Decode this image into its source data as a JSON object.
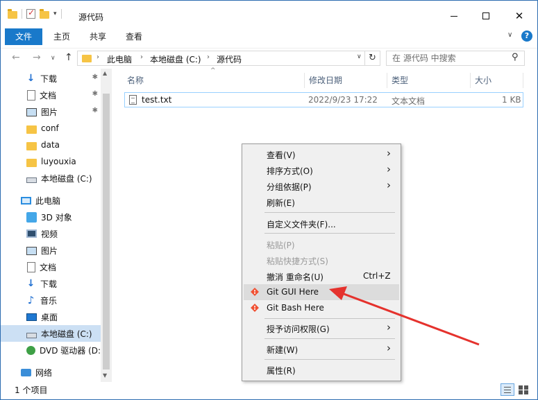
{
  "window": {
    "title": "源代码"
  },
  "ribbon": {
    "file": "文件",
    "home": "主页",
    "share": "共享",
    "view": "查看",
    "help": "?"
  },
  "address": {
    "crumbs": [
      "此电脑",
      "本地磁盘 (C:)",
      "源代码"
    ],
    "sep": "›",
    "search_placeholder": "在 源代码 中搜索"
  },
  "sidebar": {
    "items": [
      {
        "label": "下载",
        "icon": "download-icon",
        "pinned": true
      },
      {
        "label": "文档",
        "icon": "document-icon",
        "pinned": true
      },
      {
        "label": "图片",
        "icon": "picture-icon",
        "pinned": true
      },
      {
        "label": "conf",
        "icon": "folder-icon"
      },
      {
        "label": "data",
        "icon": "folder-icon"
      },
      {
        "label": "luyouxia",
        "icon": "folder-icon"
      },
      {
        "label": "本地磁盘 (C:)",
        "icon": "drive-icon"
      },
      {
        "label": "此电脑",
        "icon": "pc-icon"
      },
      {
        "label": "3D 对象",
        "icon": "3d-objects-icon"
      },
      {
        "label": "视频",
        "icon": "video-icon"
      },
      {
        "label": "图片",
        "icon": "picture-icon"
      },
      {
        "label": "文档",
        "icon": "document-icon"
      },
      {
        "label": "下载",
        "icon": "download-icon"
      },
      {
        "label": "音乐",
        "icon": "music-icon"
      },
      {
        "label": "桌面",
        "icon": "desktop-icon"
      },
      {
        "label": "本地磁盘 (C:)",
        "icon": "drive-icon",
        "selected": true
      },
      {
        "label": "DVD 驱动器 (D:",
        "icon": "dvd-icon"
      },
      {
        "label": "网络",
        "icon": "network-icon"
      }
    ]
  },
  "columns": {
    "name": "名称",
    "modified": "修改日期",
    "type": "类型",
    "size": "大小"
  },
  "files": [
    {
      "name": "test.txt",
      "modified": "2022/9/23 17:22",
      "type": "文本文档",
      "size": "1 KB"
    }
  ],
  "status": {
    "count": "1 个项目"
  },
  "context_menu": {
    "items": [
      {
        "label": "查看(V)",
        "submenu": true
      },
      {
        "label": "排序方式(O)",
        "submenu": true
      },
      {
        "label": "分组依据(P)",
        "submenu": true
      },
      {
        "label": "刷新(E)"
      },
      {
        "label": "自定义文件夹(F)..."
      },
      {
        "label": "粘贴(P)",
        "disabled": true
      },
      {
        "label": "粘贴快捷方式(S)",
        "disabled": true
      },
      {
        "label": "撤消 重命名(U)",
        "shortcut": "Ctrl+Z"
      },
      {
        "label": "Git GUI Here",
        "icon": "git-icon",
        "hover": true
      },
      {
        "label": "Git Bash Here",
        "icon": "git-icon"
      },
      {
        "label": "授予访问权限(G)",
        "submenu": true
      },
      {
        "label": "新建(W)",
        "submenu": true
      },
      {
        "label": "属性(R)"
      }
    ]
  },
  "colors": {
    "accent": "#1979ca",
    "annotation": "#e5322d",
    "git": "#f05133"
  }
}
